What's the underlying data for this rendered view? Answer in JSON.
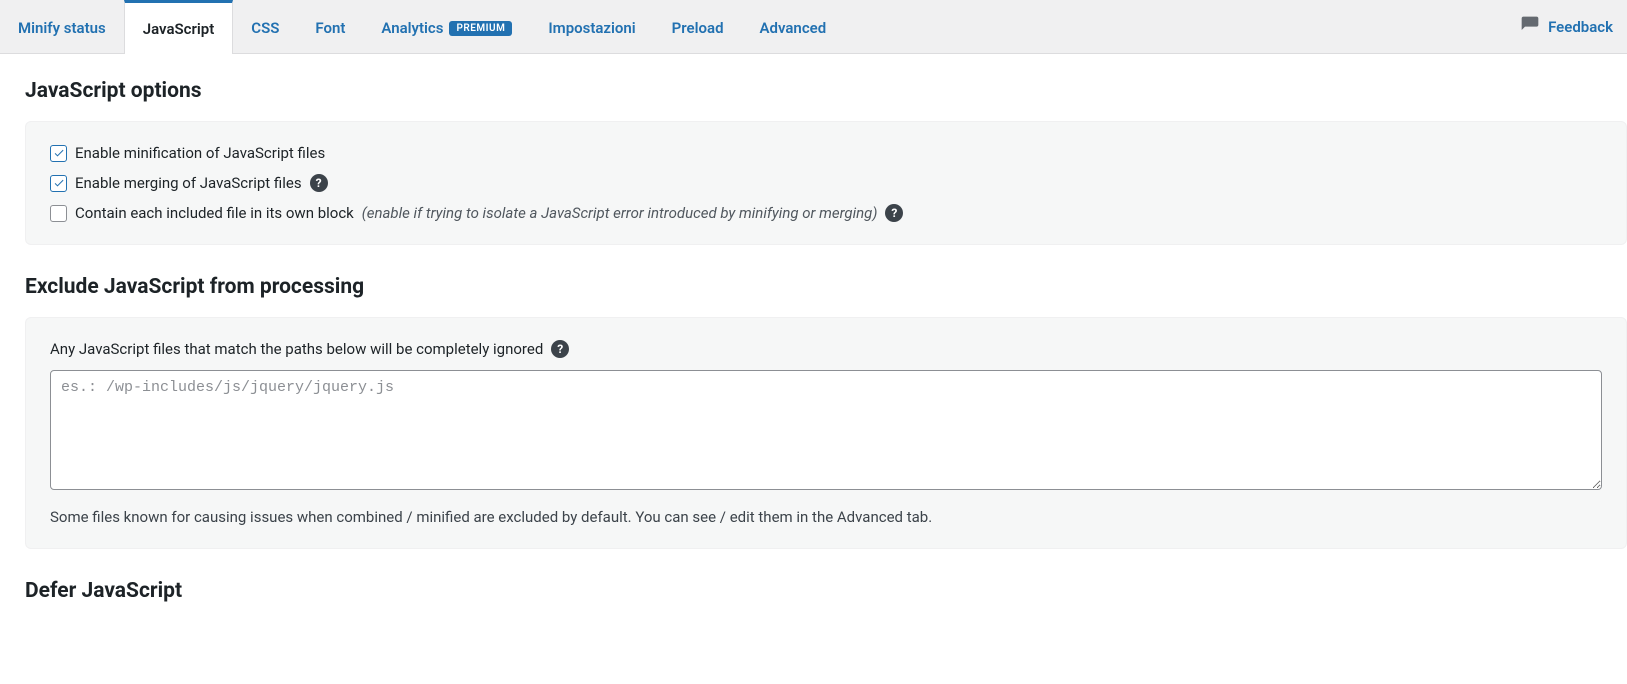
{
  "tabs": {
    "minify_status": "Minify status",
    "javascript": "JavaScript",
    "css": "CSS",
    "font": "Font",
    "analytics": "Analytics",
    "analytics_badge": "PREMIUM",
    "impostazioni": "Impostazioni",
    "preload": "Preload",
    "advanced": "Advanced"
  },
  "feedback": {
    "label": "Feedback"
  },
  "sections": {
    "js_options_heading": "JavaScript options",
    "exclude_heading": "Exclude JavaScript from processing",
    "defer_heading": "Defer JavaScript"
  },
  "options": {
    "enable_min": "Enable minification of JavaScript files",
    "enable_merge": "Enable merging of JavaScript files",
    "contain_block": "Contain each included file in its own block",
    "contain_block_hint": "(enable if trying to isolate a JavaScript error introduced by minifying or merging)"
  },
  "exclude": {
    "desc": "Any JavaScript files that match the paths below will be completely ignored",
    "placeholder": "es.: /wp-includes/js/jquery/jquery.js",
    "value": "",
    "footnote": "Some files known for causing issues when combined / minified are excluded by default. You can see / edit them in the Advanced tab."
  },
  "help_glyph": "?"
}
